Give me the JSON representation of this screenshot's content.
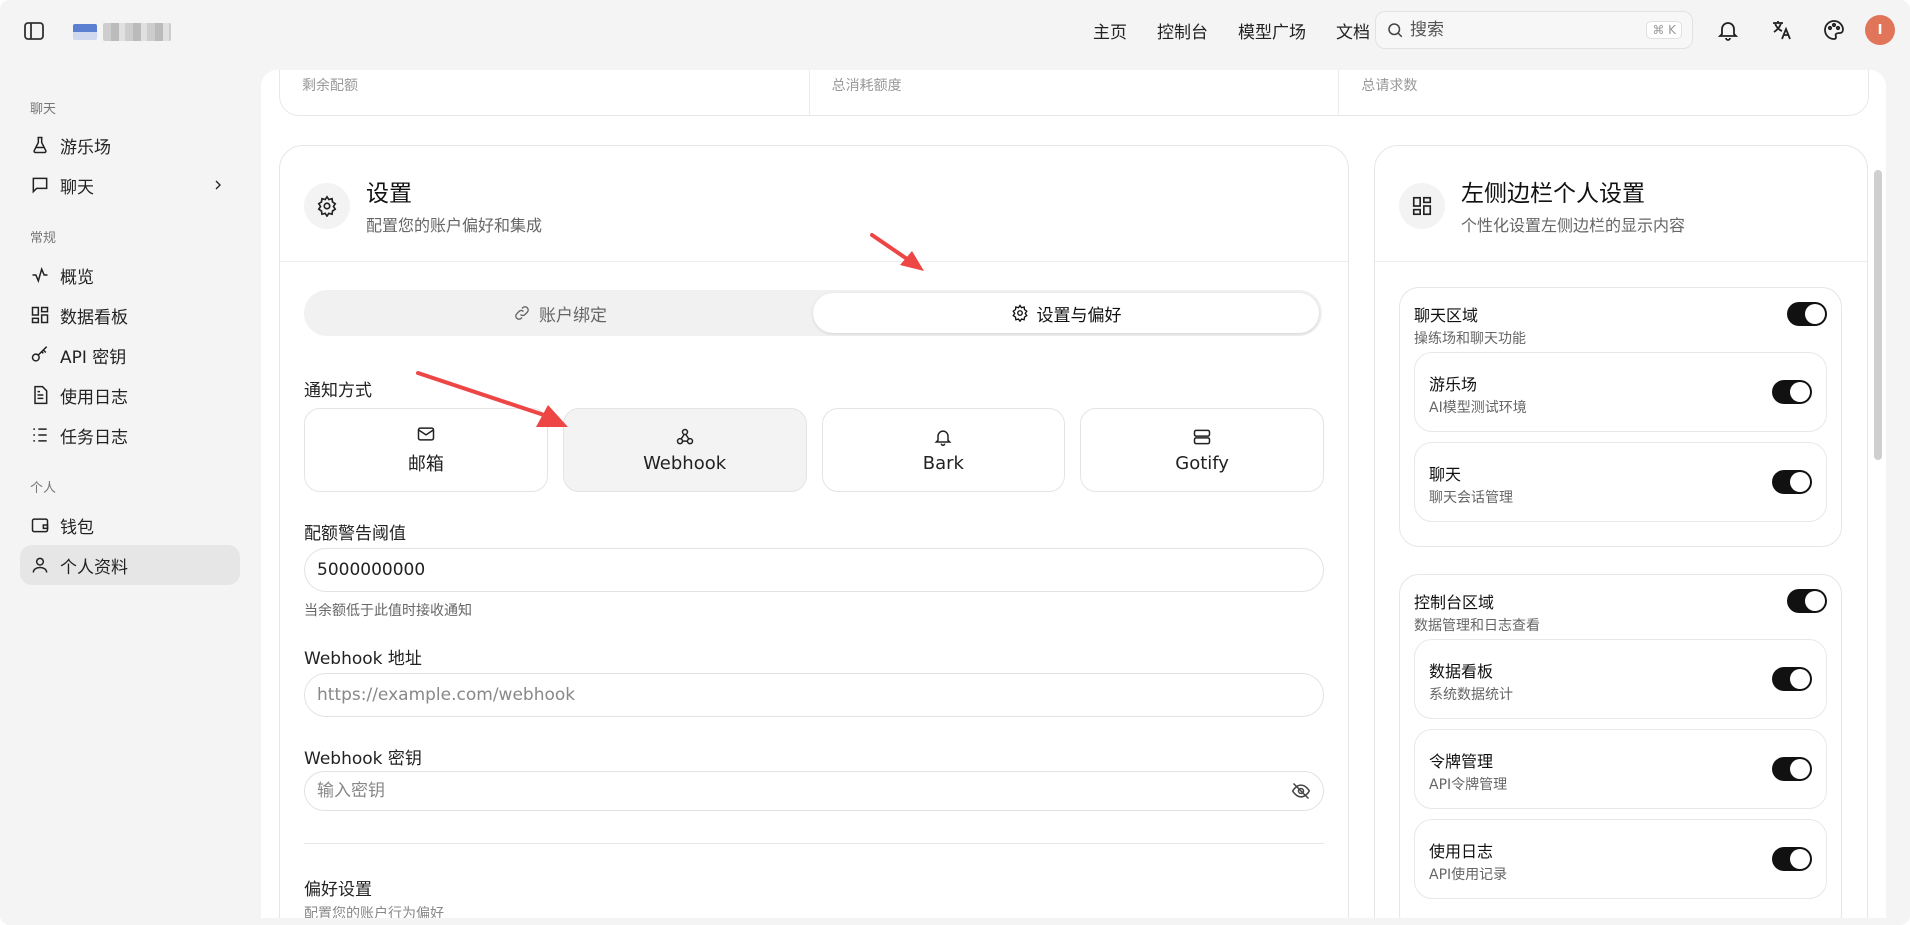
{
  "header": {
    "nav": [
      "主页",
      "控制台",
      "模型广场",
      "文档"
    ],
    "search_placeholder": "搜索",
    "search_shortcut": "⌘ K",
    "avatar_initial": "I"
  },
  "sidebar": {
    "sections": [
      {
        "title": "聊天",
        "items": [
          {
            "label": "游乐场",
            "icon": "flask-icon"
          },
          {
            "label": "聊天",
            "icon": "chat-icon"
          }
        ]
      },
      {
        "title": "常规",
        "items": [
          {
            "label": "概览",
            "icon": "activity-icon"
          },
          {
            "label": "数据看板",
            "icon": "dashboard-icon"
          },
          {
            "label": "API 密钥",
            "icon": "key-icon"
          },
          {
            "label": "使用日志",
            "icon": "file-icon"
          },
          {
            "label": "任务日志",
            "icon": "list-icon"
          }
        ]
      },
      {
        "title": "个人",
        "items": [
          {
            "label": "钱包",
            "icon": "wallet-icon"
          },
          {
            "label": "个人资料",
            "icon": "user-icon"
          }
        ]
      }
    ]
  },
  "stats": [
    "剩余配额",
    "总消耗额度",
    "总请求数"
  ],
  "settings": {
    "title": "设置",
    "subtitle": "配置您的账户偏好和集成",
    "tabs": [
      "账户绑定",
      "设置与偏好"
    ],
    "notify_label": "通知方式",
    "notify_options": [
      "邮箱",
      "Webhook",
      "Bark",
      "Gotify"
    ],
    "quota_label": "配额警告阈值",
    "quota_value": "5000000000",
    "quota_hint": "当余额低于此值时接收通知",
    "webhook_url_label": "Webhook 地址",
    "webhook_url_placeholder": "https://example.com/webhook",
    "webhook_secret_label": "Webhook 密钥",
    "webhook_secret_placeholder": "输入密钥",
    "pref_title": "偏好设置",
    "pref_sub": "配置您的账户行为偏好"
  },
  "sidebar_settings": {
    "title": "左侧边栏个人设置",
    "subtitle": "个性化设置左侧边栏的显示内容",
    "groups": [
      {
        "title": "聊天区域",
        "sub": "操练场和聊天功能",
        "enabled": true,
        "items": [
          {
            "title": "游乐场",
            "sub": "AI模型测试环境",
            "enabled": true
          },
          {
            "title": "聊天",
            "sub": "聊天会话管理",
            "enabled": true
          }
        ]
      },
      {
        "title": "控制台区域",
        "sub": "数据管理和日志查看",
        "enabled": true,
        "items": [
          {
            "title": "数据看板",
            "sub": "系统数据统计",
            "enabled": true
          },
          {
            "title": "令牌管理",
            "sub": "API令牌管理",
            "enabled": true
          },
          {
            "title": "使用日志",
            "sub": "API使用记录",
            "enabled": true
          }
        ]
      }
    ]
  },
  "colors": {
    "accent": "#111111",
    "arrow": "#ee4545",
    "avatar": "#e0755a"
  }
}
